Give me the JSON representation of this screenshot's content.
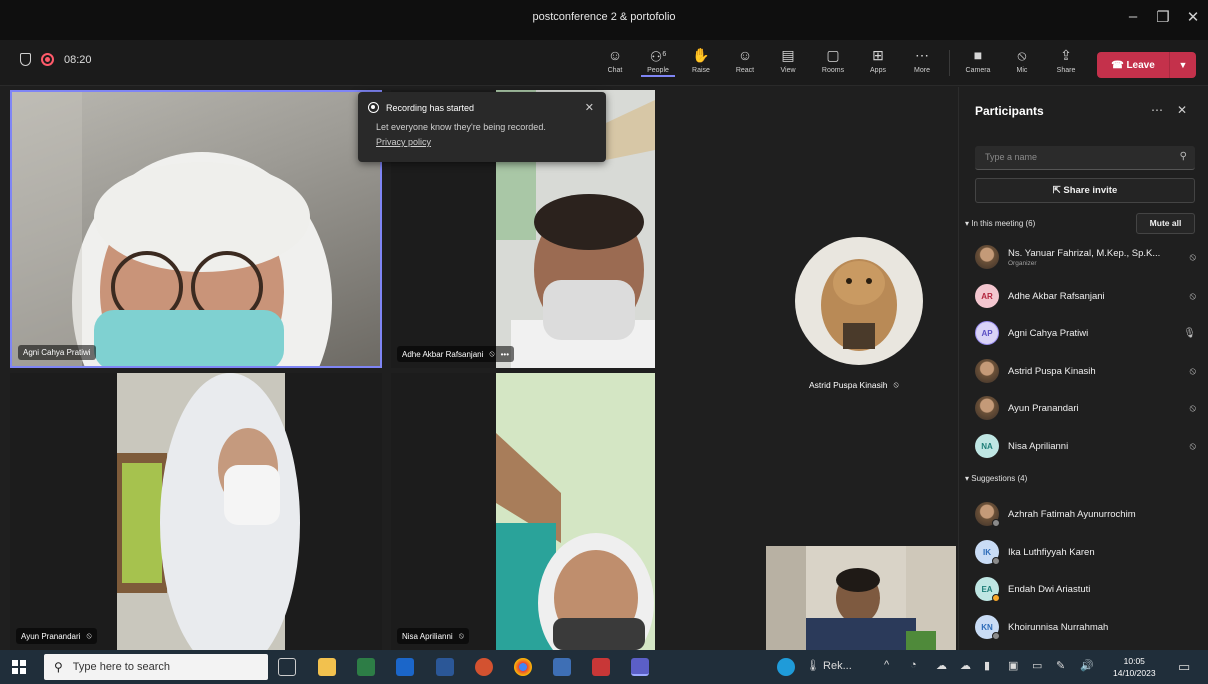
{
  "window": {
    "title": "postconference 2 & portofolio",
    "controls": [
      "–",
      "❐",
      "✕"
    ]
  },
  "toolbar": {
    "timer": "08:20",
    "buttons": [
      {
        "label": "Chat",
        "icon": "chat-icon"
      },
      {
        "label": "People",
        "icon": "people-icon",
        "count": "6"
      },
      {
        "label": "Raise",
        "icon": "hand-icon"
      },
      {
        "label": "React",
        "icon": "emoji-icon"
      },
      {
        "label": "View",
        "icon": "view-icon"
      },
      {
        "label": "Rooms",
        "icon": "rooms-icon"
      },
      {
        "label": "Apps",
        "icon": "apps-icon"
      },
      {
        "label": "More",
        "icon": "more-icon"
      },
      {
        "label": "Camera",
        "icon": "camera-icon"
      },
      {
        "label": "Mic",
        "icon": "mic-off-icon"
      },
      {
        "label": "Share",
        "icon": "share-icon"
      }
    ],
    "leave_label": "Leave",
    "leave_color": "#c4314b"
  },
  "toast": {
    "title": "Recording has started",
    "message": "Let everyone know they're being recorded.",
    "link": "Privacy policy"
  },
  "tiles": [
    {
      "name": "Agni Cahya Pratiwi",
      "active_speaker": true
    },
    {
      "name": "Adhe Akbar Rafsanjani",
      "muted": true,
      "more": "•••"
    },
    {
      "name": "Astrid Puspa Kinasih",
      "muted": true
    },
    {
      "name": "Ayun Pranandari",
      "muted": true
    },
    {
      "name": "Nisa Aprilianni",
      "muted": true
    }
  ],
  "participants_panel": {
    "title": "Participants",
    "search_placeholder": "Type a name",
    "share_invite": "Share invite",
    "in_meeting_label": "In this meeting (6)",
    "mute_all": "Mute all",
    "in_meeting": [
      {
        "name": "Ns. Yanuar Fahrizal, M.Kep., Sp.K...",
        "role": "Organizer",
        "avatar": "photo",
        "mic": "muted"
      },
      {
        "name": "Adhe Akbar Rafsanjani",
        "initials": "AR",
        "mic": "muted"
      },
      {
        "name": "Agni Cahya Pratiwi",
        "initials": "AP",
        "mic": "on"
      },
      {
        "name": "Astrid Puspa Kinasih",
        "avatar": "photo",
        "mic": "muted"
      },
      {
        "name": "Ayun Pranandari",
        "avatar": "photo",
        "mic": "muted"
      },
      {
        "name": "Nisa Aprilianni",
        "initials": "NA",
        "mic": "muted"
      }
    ],
    "suggestions_label": "Suggestions (4)",
    "suggestions": [
      {
        "name": "Azhrah Fatimah Ayunurrochim",
        "avatar": "photo"
      },
      {
        "name": "Ika Luthfiyyah Karen",
        "initials": "IK"
      },
      {
        "name": "Endah Dwi Ariastuti",
        "initials": "EA",
        "status": "away"
      },
      {
        "name": "Khoirunnisa Nurrahmah",
        "initials": "KN"
      }
    ]
  },
  "taskbar": {
    "search_placeholder": "Type here to search",
    "tray_app_label": "Rek...",
    "time": "10:05",
    "date": "14/10/2023"
  }
}
